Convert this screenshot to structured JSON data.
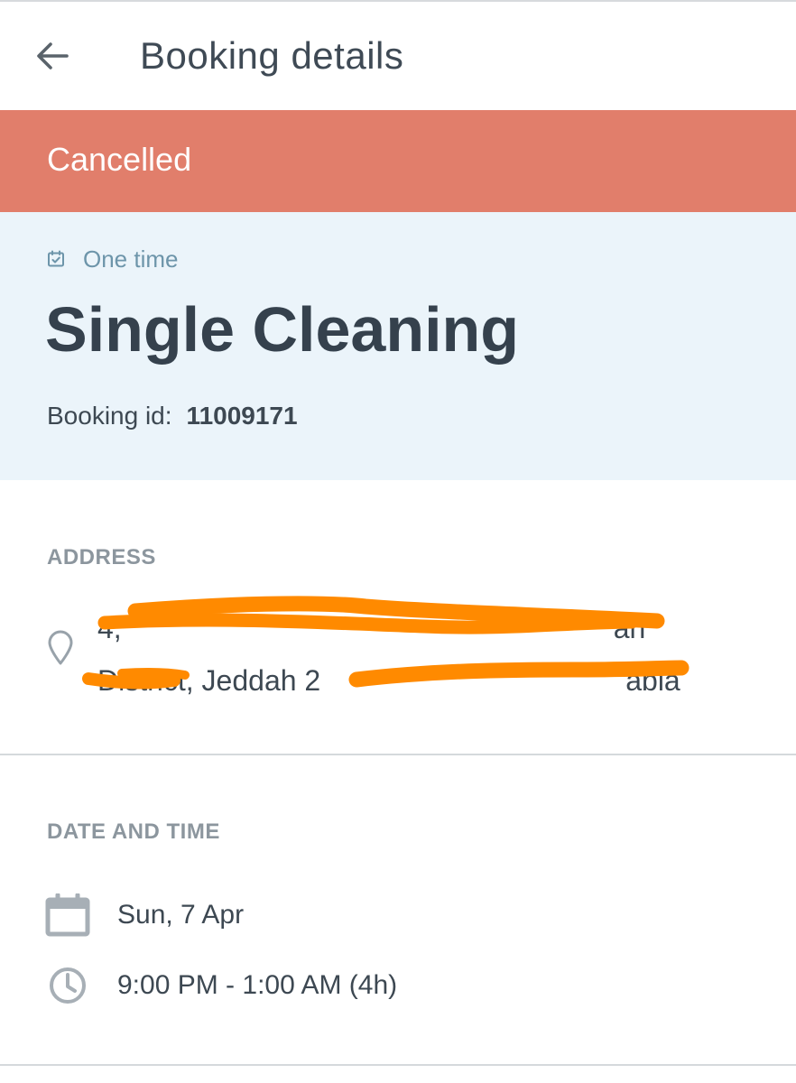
{
  "header": {
    "back_icon": "arrow-left-icon",
    "title": "Booking details"
  },
  "status": {
    "label": "Cancelled",
    "color": "#e17e6b"
  },
  "summary": {
    "frequency_icon": "calendar-check-icon",
    "frequency": "One time",
    "service": "Single Cleaning",
    "booking_id_label": "Booking id:",
    "booking_id": "11009171"
  },
  "address": {
    "heading": "ADDRESS",
    "icon": "location-pin-icon",
    "line1": "4,",
    "line1_tail": "ah",
    "line2": "District, Jeddah 2",
    "line2_tail": "abia"
  },
  "date_time": {
    "heading": "DATE AND TIME",
    "date_icon": "calendar-icon",
    "date": "Sun, 7 Apr",
    "time_icon": "clock-icon",
    "time": "9:00 PM - 1:00 AM (4h)"
  },
  "colors": {
    "accent_text": "#3d4852",
    "banner_bg": "#e17e6b",
    "card_bg": "#ebf4fa",
    "redaction": "#ff8a00"
  }
}
